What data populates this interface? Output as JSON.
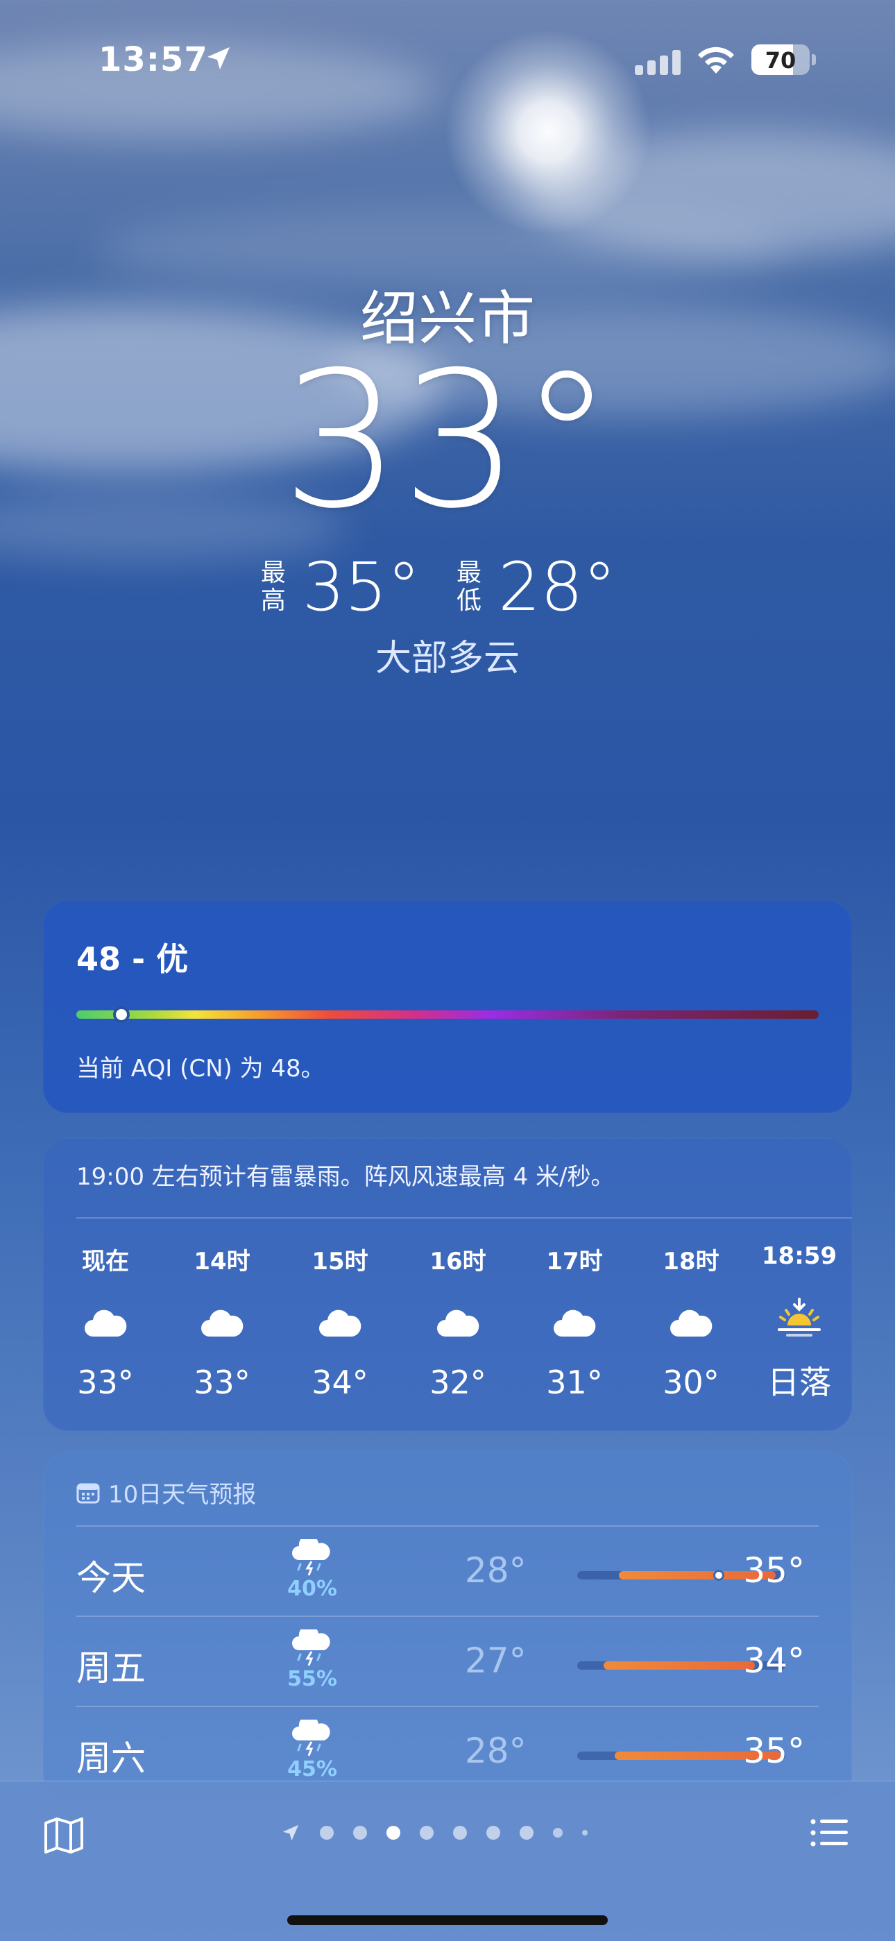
{
  "status_bar": {
    "time": "13:57",
    "battery": "70",
    "icons": [
      "location-arrow-icon",
      "cellular-signal-icon",
      "wifi-icon",
      "battery-icon"
    ]
  },
  "header": {
    "city": "绍兴市",
    "temperature": "33°",
    "high_label": "最高",
    "high": "35°",
    "low_label": "最低",
    "low": "28°",
    "condition": "大部多云"
  },
  "aqi": {
    "title": "48 - 优",
    "description": "当前 AQI (CN) 为 48。",
    "level_fraction": 0.06
  },
  "hourly": {
    "note": "19:00 左右预计有雷暴雨。阵风风速最高 4 米/秒。",
    "items": [
      {
        "time": "现在",
        "icon": "cloud-icon",
        "value": "33°"
      },
      {
        "time": "14时",
        "icon": "cloud-icon",
        "value": "33°"
      },
      {
        "time": "15时",
        "icon": "cloud-icon",
        "value": "34°"
      },
      {
        "time": "16时",
        "icon": "cloud-icon",
        "value": "32°"
      },
      {
        "time": "17时",
        "icon": "cloud-icon",
        "value": "31°"
      },
      {
        "time": "18时",
        "icon": "cloud-icon",
        "value": "30°"
      },
      {
        "time": "18:59",
        "icon": "sunset-icon",
        "value": "日落"
      }
    ]
  },
  "daily": {
    "title": "10日天气预报",
    "icon": "calendar-icon",
    "rows": [
      {
        "day": "今天",
        "icon": "thunderstorm-icon",
        "precip": "40%",
        "low": "28°",
        "high": "35°"
      },
      {
        "day": "周五",
        "icon": "thunderstorm-icon",
        "precip": "55%",
        "low": "27°",
        "high": "34°"
      },
      {
        "day": "周六",
        "icon": "thunderstorm-icon",
        "precip": "45%",
        "low": "28°",
        "high": "35°"
      }
    ]
  },
  "toolbar": {
    "icons": [
      "map-icon",
      "location-arrow-icon",
      "list-icon"
    ],
    "page_count": 9,
    "active_page": 3
  },
  "colors": {
    "accent_precip": "#8fd0ff",
    "range_bar": "#f08a3a",
    "aqi_card": "#2456be"
  }
}
